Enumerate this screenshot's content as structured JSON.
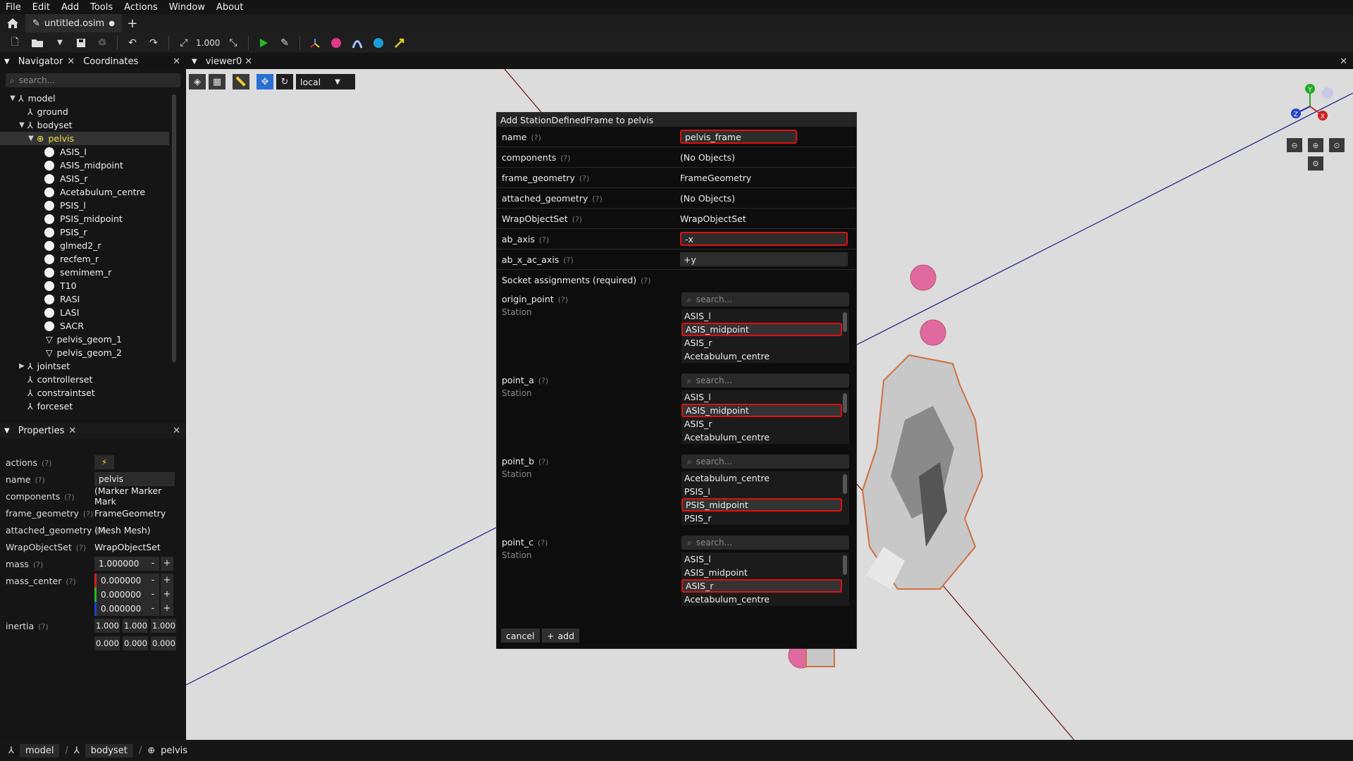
{
  "menu": [
    "File",
    "Edit",
    "Add",
    "Tools",
    "Actions",
    "Window",
    "About"
  ],
  "file_tab": {
    "name": "untitled.osim",
    "modified": "●"
  },
  "toolbar": {
    "scale": "1.000"
  },
  "navigator": {
    "tab1": "Navigator",
    "tab2": "Coordinates",
    "search_placeholder": "search...",
    "items": [
      {
        "label": "model",
        "indent": 0,
        "arrow": "▼",
        "icon": "model"
      },
      {
        "label": "ground",
        "indent": 1,
        "arrow": "",
        "icon": "ground"
      },
      {
        "label": "bodyset",
        "indent": 1,
        "arrow": "▼",
        "icon": "model"
      },
      {
        "label": "pelvis",
        "indent": 2,
        "arrow": "▼",
        "icon": "body"
      },
      {
        "label": "ASIS_l",
        "indent": 3,
        "arrow": "",
        "icon": "dot"
      },
      {
        "label": "ASIS_midpoint",
        "indent": 3,
        "arrow": "",
        "icon": "dot"
      },
      {
        "label": "ASIS_r",
        "indent": 3,
        "arrow": "",
        "icon": "dot"
      },
      {
        "label": "Acetabulum_centre",
        "indent": 3,
        "arrow": "",
        "icon": "dot"
      },
      {
        "label": "PSIS_l",
        "indent": 3,
        "arrow": "",
        "icon": "dot"
      },
      {
        "label": "PSIS_midpoint",
        "indent": 3,
        "arrow": "",
        "icon": "dot"
      },
      {
        "label": "PSIS_r",
        "indent": 3,
        "arrow": "",
        "icon": "dot"
      },
      {
        "label": "glmed2_r",
        "indent": 3,
        "arrow": "",
        "icon": "dot"
      },
      {
        "label": "recfem_r",
        "indent": 3,
        "arrow": "",
        "icon": "dot"
      },
      {
        "label": "semimem_r",
        "indent": 3,
        "arrow": "",
        "icon": "dot"
      },
      {
        "label": "T10",
        "indent": 3,
        "arrow": "",
        "icon": "dot"
      },
      {
        "label": "RASI",
        "indent": 3,
        "arrow": "",
        "icon": "dot"
      },
      {
        "label": "LASI",
        "indent": 3,
        "arrow": "",
        "icon": "dot"
      },
      {
        "label": "SACR",
        "indent": 3,
        "arrow": "",
        "icon": "dot"
      },
      {
        "label": "pelvis_geom_1",
        "indent": 3,
        "arrow": "",
        "icon": "mesh"
      },
      {
        "label": "pelvis_geom_2",
        "indent": 3,
        "arrow": "",
        "icon": "mesh"
      },
      {
        "label": "jointset",
        "indent": 1,
        "arrow": "▶",
        "icon": "model"
      },
      {
        "label": "controllerset",
        "indent": 1,
        "arrow": "",
        "icon": "model"
      },
      {
        "label": "constraintset",
        "indent": 1,
        "arrow": "",
        "icon": "model"
      },
      {
        "label": "forceset",
        "indent": 1,
        "arrow": "",
        "icon": "model"
      }
    ]
  },
  "properties": {
    "title": "Properties",
    "rows": [
      {
        "label": "actions",
        "value": ""
      },
      {
        "label": "name",
        "value": "pelvis"
      },
      {
        "label": "components",
        "value": "(Marker Marker Mark"
      },
      {
        "label": "frame_geometry",
        "value": "FrameGeometry"
      },
      {
        "label": "attached_geometry",
        "value": "(Mesh Mesh)"
      },
      {
        "label": "WrapObjectSet",
        "value": "WrapObjectSet"
      },
      {
        "label": "mass",
        "value": "1.000000"
      },
      {
        "label": "mass_center",
        "value": "0.000000"
      },
      {
        "label": "",
        "value": "0.000000"
      },
      {
        "label": "",
        "value": "0.000000"
      },
      {
        "label": "inertia",
        "value": ""
      }
    ],
    "inertia": [
      "1.000",
      "1.000",
      "1.000",
      "0.000",
      "0.000",
      "0.000"
    ],
    "q": "(?)"
  },
  "viewer": {
    "tab": "viewer0",
    "mode": "local"
  },
  "dialog": {
    "title": "Add StationDefinedFrame to pelvis",
    "q": "(?)",
    "rows": [
      {
        "label": "name",
        "value": "pelvis_frame"
      },
      {
        "label": "components",
        "value": "(No Objects)"
      },
      {
        "label": "frame_geometry",
        "value": "FrameGeometry"
      },
      {
        "label": "attached_geometry",
        "value": "(No Objects)"
      },
      {
        "label": "WrapObjectSet",
        "value": "WrapObjectSet"
      },
      {
        "label": "ab_axis",
        "value": "-x"
      },
      {
        "label": "ab_x_ac_axis",
        "value": "+y"
      }
    ],
    "socket_header": "Socket assignments (required)",
    "search_placeholder": "search...",
    "sockets": [
      {
        "label": "origin_point",
        "type": "Station",
        "items": [
          "ASIS_l",
          "ASIS_midpoint",
          "ASIS_r",
          "Acetabulum_centre"
        ],
        "selected": 1
      },
      {
        "label": "point_a",
        "type": "Station",
        "items": [
          "ASIS_l",
          "ASIS_midpoint",
          "ASIS_r",
          "Acetabulum_centre"
        ],
        "selected": 1
      },
      {
        "label": "point_b",
        "type": "Station",
        "items": [
          "Acetabulum_centre",
          "PSIS_l",
          "PSIS_midpoint",
          "PSIS_r"
        ],
        "selected": 2
      },
      {
        "label": "point_c",
        "type": "Station",
        "items": [
          "ASIS_l",
          "ASIS_midpoint",
          "ASIS_r",
          "Acetabulum_centre"
        ],
        "selected": 2
      }
    ],
    "cancel": "cancel",
    "add": "add"
  },
  "gizmo": {
    "y": "Y",
    "z": "Z",
    "x": "X"
  },
  "breadcrumb": [
    "model",
    "bodyset",
    "pelvis"
  ]
}
